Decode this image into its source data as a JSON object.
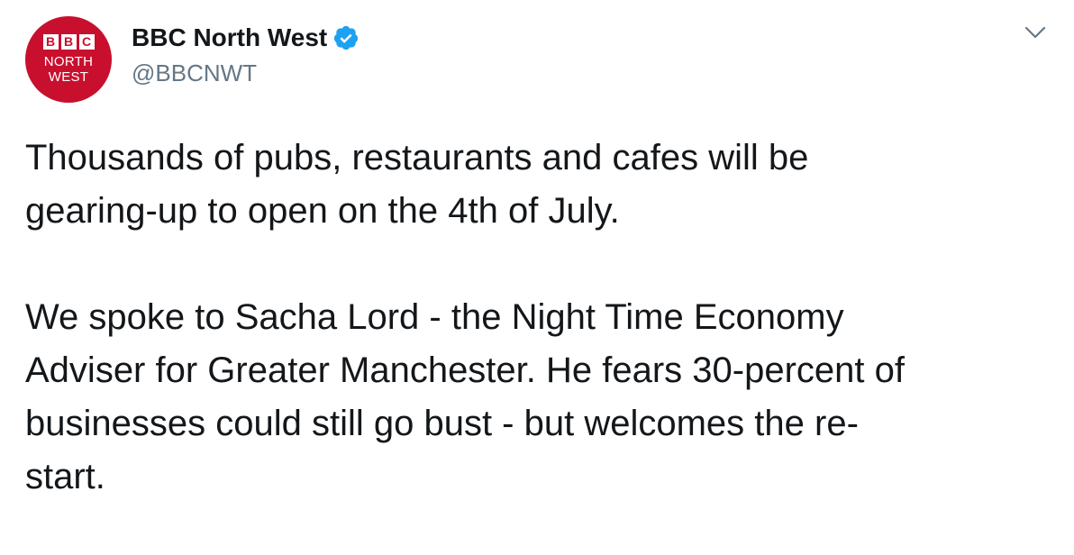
{
  "account": {
    "display_name": "BBC North West",
    "handle": "@BBCNWT",
    "verified": true,
    "avatar": {
      "logo_letters": [
        "B",
        "B",
        "C"
      ],
      "line1": "NORTH",
      "line2": "WEST",
      "background_color": "#c8102e"
    }
  },
  "icons": {
    "verified": "verified-badge-icon",
    "menu": "chevron-down-icon"
  },
  "colors": {
    "verified_blue": "#1da1f2",
    "secondary_text": "#657786",
    "primary_text": "#14171a"
  },
  "tweet": {
    "paragraph1_line1": "Thousands of pubs, restaurants and cafes will be",
    "paragraph1_line2": "gearing-up to open on the 4th of July.",
    "paragraph2_line1": "We spoke to Sacha Lord - the Night Time Economy",
    "paragraph2_line2": "Adviser for Greater Manchester. He fears 30-percent of",
    "paragraph2_line3": "businesses could still go bust - but welcomes the re-",
    "paragraph2_line4": "start."
  }
}
